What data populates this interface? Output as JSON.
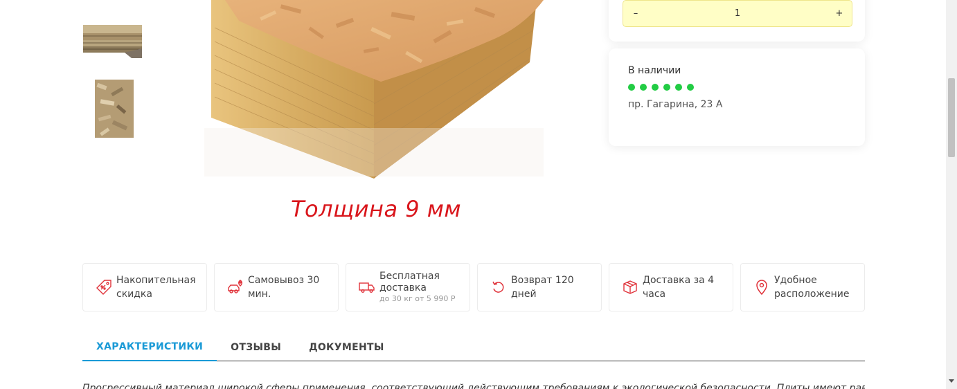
{
  "gallery": {
    "caption": "Толщина 9 мм"
  },
  "quantity": {
    "minus_label": "–",
    "value": "1",
    "plus_label": "+"
  },
  "availability": {
    "title": "В наличии",
    "stock_level": 6,
    "address": "пр. Гагарина, 23 А",
    "dot_color": "#22cc44"
  },
  "features": [
    {
      "label": "Накопительная скидка",
      "icon": "discount-tag-icon"
    },
    {
      "label": "Самовывоз 30 мин.",
      "icon": "car-pin-icon"
    },
    {
      "label": "Бесплатная доставка",
      "sub": "до 30 кг от 5 990 Р",
      "icon": "truck-icon"
    },
    {
      "label": "Возврат 120 дней",
      "icon": "return-icon"
    },
    {
      "label": "Доставка за 4 часа",
      "icon": "box-icon"
    },
    {
      "label": "Удобное расположение",
      "icon": "location-pin-icon"
    }
  ],
  "tabs": [
    {
      "label": "ХАРАКТЕРИСТИКИ",
      "active": true
    },
    {
      "label": "ОТЗЫВЫ",
      "active": false
    },
    {
      "label": "ДОКУМЕНТЫ",
      "active": false
    }
  ],
  "description": "Прогрессивный материал широкой сферы применения, соответствующий действующим требованиям к экологической безопасности. Плиты имеют равномерную",
  "colors": {
    "accent": "#1a9ad6",
    "icon_red": "#e0323a",
    "caption_red": "#d9161c",
    "qty_bg": "#fffec6"
  }
}
